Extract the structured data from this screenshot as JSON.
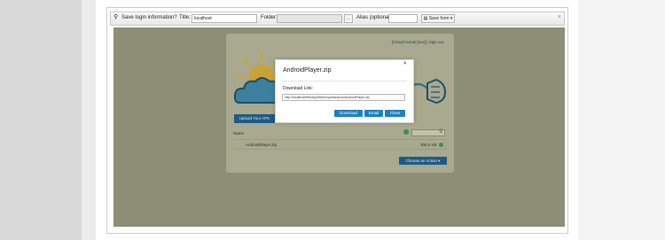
{
  "login_bar": {
    "prompt": "Save login information?",
    "title_label": "Title:",
    "title_value": "localhost",
    "folder_label": "Folder:",
    "folder_browse": "...",
    "alias_label": "Alias (optional):",
    "alias_value": "",
    "save_button": "Save form"
  },
  "app": {
    "top_links": "[Cloud Home]  [xxx]  [ Sign out",
    "upload_button": "Upload Your APK",
    "list_header": "Name",
    "file": {
      "name": "AndroidPlayer.zip",
      "size": "300.2 KB"
    },
    "action_button": "Choose an Action"
  },
  "modal": {
    "title": "AndroidPlayer.zip",
    "close": "×",
    "download_label": "Download Link:",
    "download_url": "http://localhost/filesApp/fieldrequestsstuck/AndroidPlayer.zip",
    "buttons": {
      "download": "Download",
      "email": "Email",
      "close": "Close"
    }
  },
  "colors": {
    "overlay": "#8c8e75",
    "accent": "#1f7fc0"
  }
}
